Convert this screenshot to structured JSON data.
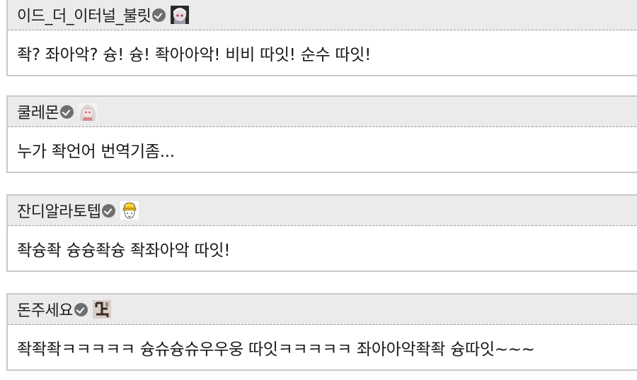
{
  "comments": [
    {
      "username": "이드_더_이터널_불릿",
      "avatar_icon": "anime-girl-avatar-icon",
      "text": "좍? 좌아악? 슝! 슝! 좍아아악! 비비 따잇! 순수 따잇!"
    },
    {
      "username": "쿨레몬",
      "avatar_icon": "white-hair-girl-avatar-icon",
      "text": "누가 좍언어 번역기좀..."
    },
    {
      "username": "잔디알라토텝",
      "avatar_icon": "yellow-hat-character-avatar-icon",
      "text": "좍슝좍 슝슝좍슝 좍좌아악 따잇!"
    },
    {
      "username": "돈주세요",
      "avatar_icon": "symbol-avatar-icon",
      "text": "좍좍좍ㅋㅋㅋㅋㅋ 슝슈슝슈우우웅 따잇ㅋㅋㅋㅋㅋ 좌아아악좍좍 슝따잇~~~"
    }
  ],
  "colors": {
    "header_bg": "#ebebeb",
    "border": "#c9c9c9",
    "verified_badge": "#6f6f6f"
  }
}
